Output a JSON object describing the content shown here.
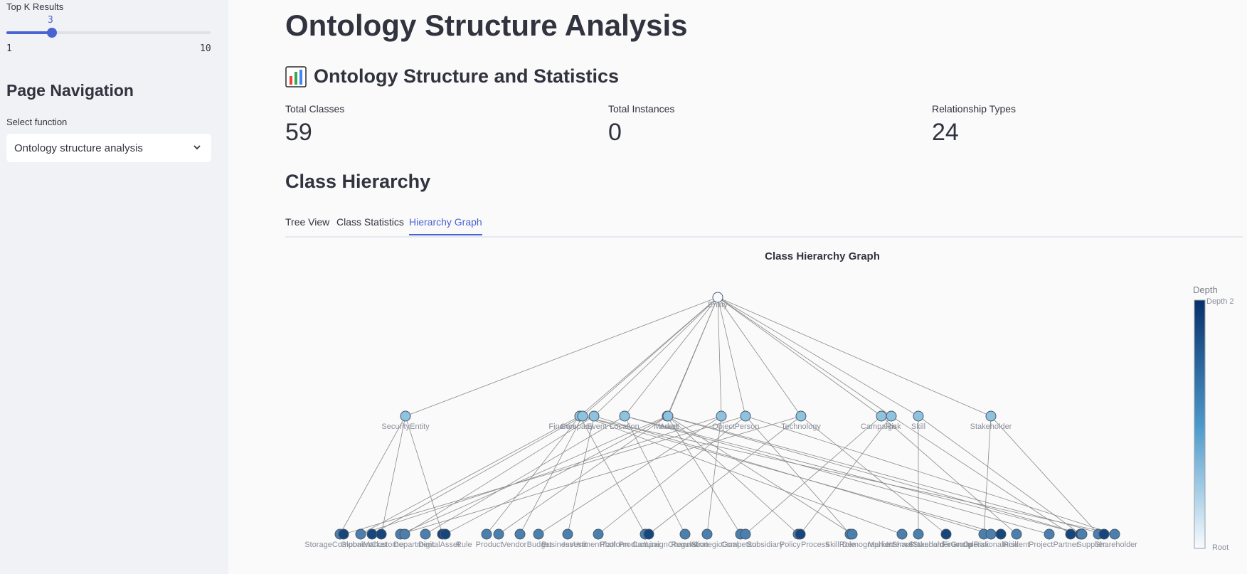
{
  "sidebar": {
    "slider": {
      "label": "Top K Results",
      "value": 3,
      "min": 1,
      "max": 10,
      "value_text": "3",
      "min_text": "1",
      "max_text": "10"
    },
    "nav_title": "Page Navigation",
    "select_label": "Select function",
    "select_value": "Ontology structure analysis"
  },
  "main": {
    "title": "Ontology Structure Analysis",
    "section_title": "Ontology Structure and Statistics",
    "metrics": [
      {
        "label": "Total Classes",
        "value": "59"
      },
      {
        "label": "Total Instances",
        "value": "0"
      },
      {
        "label": "Relationship Types",
        "value": "24"
      }
    ],
    "hierarchy_title": "Class Hierarchy",
    "tabs": [
      {
        "label": "Tree View",
        "active": false
      },
      {
        "label": "Class Statistics",
        "active": false
      },
      {
        "label": "Hierarchy Graph",
        "active": true
      }
    ]
  },
  "graph": {
    "title": "Class Hierarchy Graph",
    "colorbar": {
      "title": "Depth",
      "top_label": "Depth 2",
      "bottom_label": "Root"
    },
    "colors": {
      "root": "#f7fbff",
      "depth1": "#8ec2de",
      "depth2_light": "#4a7fae",
      "depth2_dark": "#17467d",
      "edge": "#8a8a8a",
      "accent": "#4a63d3"
    },
    "root": {
      "label": "Entity"
    },
    "level1": [
      "SecurityEntity",
      "Finance",
      "Company",
      "Event",
      "Location",
      "Market",
      "Asset",
      "Object",
      "Person",
      "Technology",
      "Campaign",
      "Risk",
      "Skill",
      "Stakeholder"
    ],
    "level2_overlapping_labels": [
      "StorageComponent",
      "GlobalMarket",
      "Customer",
      "Department",
      "DigitalAsset",
      "Rule",
      "Product",
      "Vendor",
      "Budget",
      "BusinessUnit",
      "InvestmentTool",
      "Platform",
      "ProductLine",
      "CampaignChannel",
      "Regulation",
      "StrategicGoal",
      "Competitor",
      "Subsidiary",
      "Policy",
      "Process",
      "SkillRole",
      "Demographic",
      "MarketShare",
      "InternalStandard",
      "StakeholderGroup",
      "FinancialRisk",
      "OperationalRisk",
      "Incident",
      "Project",
      "Partner",
      "Supplier",
      "Shareholder"
    ]
  }
}
